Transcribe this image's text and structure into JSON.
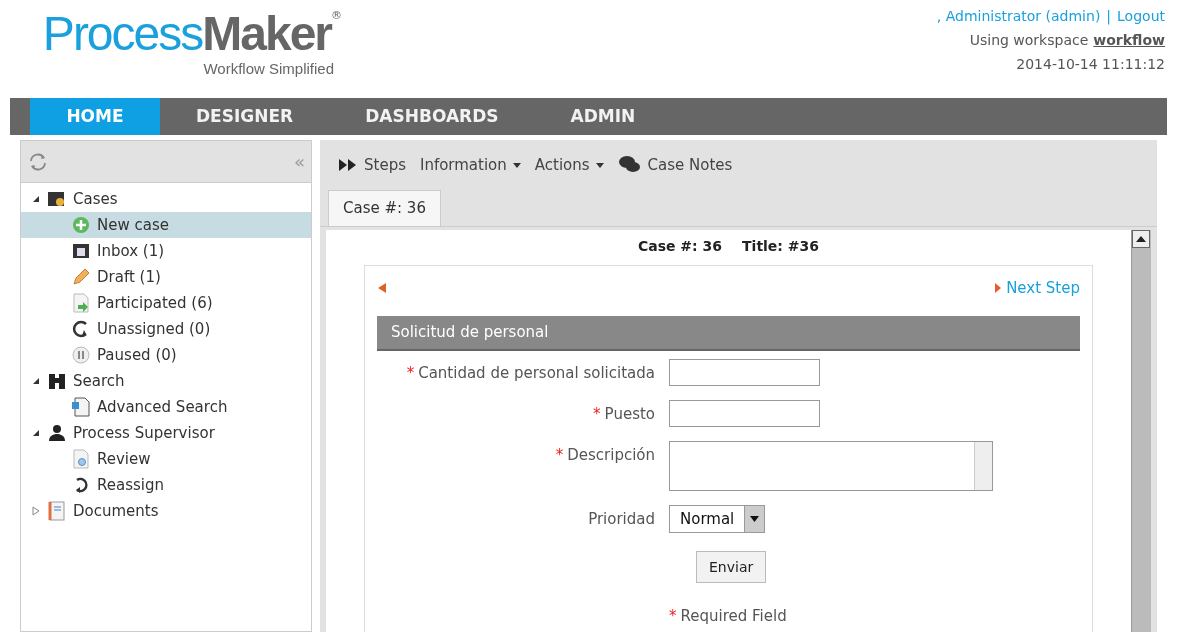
{
  "logo": {
    "brand_light": "Process",
    "brand_bold": "Maker",
    "registered": "®",
    "tagline": "Workflow Simplified"
  },
  "user_bar": {
    "user": ", Administrator (admin)",
    "separator": "|",
    "logout": "Logout",
    "workspace_label": "Using workspace",
    "workspace": "workflow",
    "datetime": "2014-10-14 11:11:12"
  },
  "nav": [
    {
      "label": "HOME",
      "selected": true
    },
    {
      "label": "DESIGNER",
      "selected": false
    },
    {
      "label": "DASHBOARDS",
      "selected": false
    },
    {
      "label": "ADMIN",
      "selected": false
    }
  ],
  "sidebar": {
    "collapse": "«",
    "tree": [
      {
        "label": "Cases",
        "kind": "cases",
        "expanded": true,
        "selected": false,
        "children": [
          {
            "label": "New case",
            "kind": "new",
            "selected": true
          },
          {
            "label": "Inbox (1)",
            "kind": "inbox",
            "selected": false
          },
          {
            "label": "Draft (1)",
            "kind": "draft",
            "selected": false
          },
          {
            "label": "Participated (6)",
            "kind": "participated",
            "selected": false
          },
          {
            "label": "Unassigned (0)",
            "kind": "unassigned",
            "selected": false
          },
          {
            "label": "Paused (0)",
            "kind": "paused",
            "selected": false
          }
        ]
      },
      {
        "label": "Search",
        "kind": "search",
        "expanded": true,
        "selected": false,
        "children": [
          {
            "label": "Advanced Search",
            "kind": "advanced",
            "selected": false
          }
        ]
      },
      {
        "label": "Process Supervisor",
        "kind": "supervisor",
        "expanded": true,
        "selected": false,
        "children": [
          {
            "label": "Review",
            "kind": "review",
            "selected": false
          },
          {
            "label": "Reassign",
            "kind": "reassign",
            "selected": false
          }
        ]
      },
      {
        "label": "Documents",
        "kind": "documents",
        "expanded": false,
        "selected": false
      }
    ]
  },
  "toolbar": [
    {
      "label": "Steps",
      "kind": "steps"
    },
    {
      "label": "Information",
      "kind": "menu"
    },
    {
      "label": "Actions",
      "kind": "menu"
    },
    {
      "label": "Case Notes",
      "kind": "notes"
    }
  ],
  "tabs": [
    {
      "label": "Case #: 36",
      "selected": true
    }
  ],
  "case_header": {
    "case": "Case #: 36",
    "title": "Title: #36"
  },
  "form": {
    "next_step": "Next Step",
    "section": "Solicitud de personal",
    "fields": [
      {
        "label": "Cantidad de personal solicitada",
        "kind": "text",
        "required": true
      },
      {
        "label": "Puesto",
        "kind": "text",
        "required": true
      },
      {
        "label": "Descripción",
        "kind": "textarea",
        "required": true
      },
      {
        "label": "Prioridad",
        "kind": "select",
        "required": false,
        "value": "Normal"
      }
    ],
    "submit": "Enviar",
    "required_mark": "*",
    "required_note": "Required Field"
  }
}
